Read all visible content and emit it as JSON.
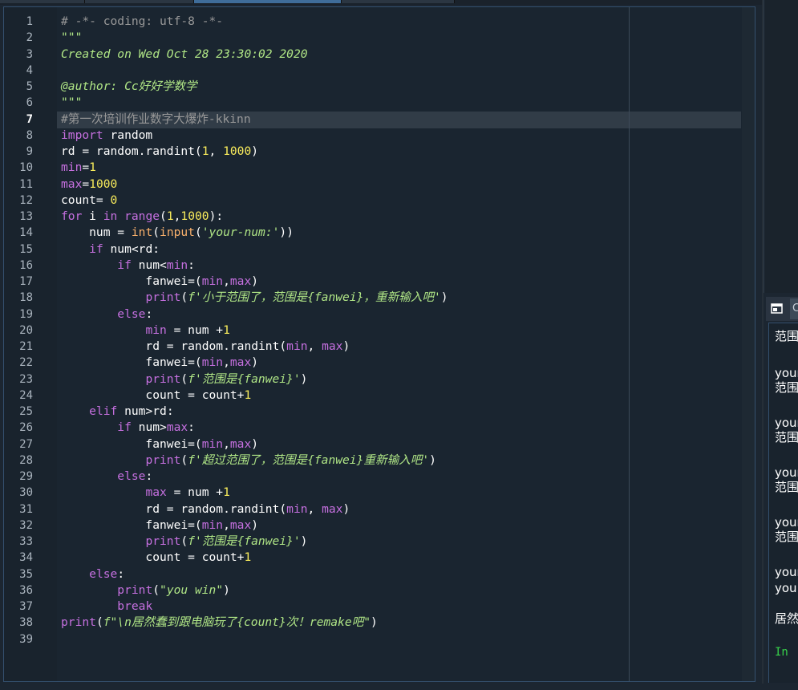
{
  "editor": {
    "current_line": 7,
    "lines": [
      [
        {
          "t": "# -*- coding: utf-8 -*-",
          "c": "cm"
        }
      ],
      [
        {
          "t": "\"\"\"",
          "c": "str"
        }
      ],
      [
        {
          "t": "Created on Wed Oct 28 23:30:02 2020",
          "c": "str"
        }
      ],
      [],
      [
        {
          "t": "@author: Cc好好学数学",
          "c": "str"
        }
      ],
      [
        {
          "t": "\"\"\"",
          "c": "str"
        }
      ],
      [
        {
          "t": "#第一次培训作业数字大爆炸-kkinn",
          "c": "cm"
        }
      ],
      [
        {
          "t": "import",
          "c": "kw"
        },
        {
          "t": " random"
        }
      ],
      [
        {
          "t": "rd = random.randint("
        },
        {
          "t": "1",
          "c": "num"
        },
        {
          "t": ", "
        },
        {
          "t": "1000",
          "c": "num"
        },
        {
          "t": ")"
        }
      ],
      [
        {
          "t": "min",
          "c": "var"
        },
        {
          "t": "="
        },
        {
          "t": "1",
          "c": "num"
        }
      ],
      [
        {
          "t": "max",
          "c": "var"
        },
        {
          "t": "="
        },
        {
          "t": "1000",
          "c": "num"
        }
      ],
      [
        {
          "t": "count= "
        },
        {
          "t": "0",
          "c": "num"
        }
      ],
      [
        {
          "t": "for",
          "c": "kw"
        },
        {
          "t": " i "
        },
        {
          "t": "in",
          "c": "kw"
        },
        {
          "t": " "
        },
        {
          "t": "range",
          "c": "var"
        },
        {
          "t": "("
        },
        {
          "t": "1",
          "c": "num"
        },
        {
          "t": ","
        },
        {
          "t": "1000",
          "c": "num"
        },
        {
          "t": "):"
        }
      ],
      [
        {
          "t": "    num = "
        },
        {
          "t": "int",
          "c": "bi"
        },
        {
          "t": "("
        },
        {
          "t": "input",
          "c": "bi"
        },
        {
          "t": "("
        },
        {
          "t": "'your-num:'",
          "c": "str"
        },
        {
          "t": "))"
        }
      ],
      [
        {
          "t": "    "
        },
        {
          "t": "if",
          "c": "kw"
        },
        {
          "t": " num<rd:"
        }
      ],
      [
        {
          "t": "        "
        },
        {
          "t": "if",
          "c": "kw"
        },
        {
          "t": " num<"
        },
        {
          "t": "min",
          "c": "var"
        },
        {
          "t": ":"
        }
      ],
      [
        {
          "t": "            fanwei=("
        },
        {
          "t": "min",
          "c": "var"
        },
        {
          "t": ","
        },
        {
          "t": "max",
          "c": "var"
        },
        {
          "t": ")"
        }
      ],
      [
        {
          "t": "            "
        },
        {
          "t": "print",
          "c": "var"
        },
        {
          "t": "("
        },
        {
          "t": "f'小于范围了，范围是{fanwei}，重新输入吧'",
          "c": "str"
        },
        {
          "t": ")"
        }
      ],
      [
        {
          "t": "        "
        },
        {
          "t": "else",
          "c": "kw"
        },
        {
          "t": ":"
        }
      ],
      [
        {
          "t": "            "
        },
        {
          "t": "min",
          "c": "var"
        },
        {
          "t": " = num +"
        },
        {
          "t": "1",
          "c": "num"
        }
      ],
      [
        {
          "t": "            rd = random.randint("
        },
        {
          "t": "min",
          "c": "var"
        },
        {
          "t": ", "
        },
        {
          "t": "max",
          "c": "var"
        },
        {
          "t": ")"
        }
      ],
      [
        {
          "t": "            fanwei=("
        },
        {
          "t": "min",
          "c": "var"
        },
        {
          "t": ","
        },
        {
          "t": "max",
          "c": "var"
        },
        {
          "t": ")"
        }
      ],
      [
        {
          "t": "            "
        },
        {
          "t": "print",
          "c": "var"
        },
        {
          "t": "("
        },
        {
          "t": "f'范围是{fanwei}'",
          "c": "str"
        },
        {
          "t": ")"
        }
      ],
      [
        {
          "t": "            count = count+"
        },
        {
          "t": "1",
          "c": "num"
        }
      ],
      [
        {
          "t": "    "
        },
        {
          "t": "elif",
          "c": "kw"
        },
        {
          "t": " num>rd:"
        }
      ],
      [
        {
          "t": "        "
        },
        {
          "t": "if",
          "c": "kw"
        },
        {
          "t": " num>"
        },
        {
          "t": "max",
          "c": "var"
        },
        {
          "t": ":"
        }
      ],
      [
        {
          "t": "            fanwei=("
        },
        {
          "t": "min",
          "c": "var"
        },
        {
          "t": ","
        },
        {
          "t": "max",
          "c": "var"
        },
        {
          "t": ")"
        }
      ],
      [
        {
          "t": "            "
        },
        {
          "t": "print",
          "c": "var"
        },
        {
          "t": "("
        },
        {
          "t": "f'超过范围了，范围是{fanwei}重新输入吧'",
          "c": "str"
        },
        {
          "t": ")"
        }
      ],
      [
        {
          "t": "        "
        },
        {
          "t": "else",
          "c": "kw"
        },
        {
          "t": ":"
        }
      ],
      [
        {
          "t": "            "
        },
        {
          "t": "max",
          "c": "var"
        },
        {
          "t": " = num +"
        },
        {
          "t": "1",
          "c": "num"
        }
      ],
      [
        {
          "t": "            rd = random.randint("
        },
        {
          "t": "min",
          "c": "var"
        },
        {
          "t": ", "
        },
        {
          "t": "max",
          "c": "var"
        },
        {
          "t": ")"
        }
      ],
      [
        {
          "t": "            fanwei=("
        },
        {
          "t": "min",
          "c": "var"
        },
        {
          "t": ","
        },
        {
          "t": "max",
          "c": "var"
        },
        {
          "t": ")"
        }
      ],
      [
        {
          "t": "            "
        },
        {
          "t": "print",
          "c": "var"
        },
        {
          "t": "("
        },
        {
          "t": "f'范围是{fanwei}'",
          "c": "str"
        },
        {
          "t": ")"
        }
      ],
      [
        {
          "t": "            count = count+"
        },
        {
          "t": "1",
          "c": "num"
        }
      ],
      [
        {
          "t": "    "
        },
        {
          "t": "else",
          "c": "kw"
        },
        {
          "t": ":"
        }
      ],
      [
        {
          "t": "        "
        },
        {
          "t": "print",
          "c": "var"
        },
        {
          "t": "("
        },
        {
          "t": "\"you win\"",
          "c": "str"
        },
        {
          "t": ")"
        }
      ],
      [
        {
          "t": "        "
        },
        {
          "t": "break",
          "c": "kw"
        }
      ],
      [
        {
          "t": "print",
          "c": "var"
        },
        {
          "t": "("
        },
        {
          "t": "f\"\\n居然蠢到跟电脑玩了{count}次！remake吧\"",
          "c": "str"
        },
        {
          "t": ")"
        }
      ],
      []
    ]
  },
  "console": {
    "tab_label": "C",
    "lines": [
      {
        "text": "范围",
        "kind": "out"
      },
      {
        "text": "",
        "kind": "out"
      },
      {
        "text": "your",
        "kind": "out"
      },
      {
        "text": "范围",
        "kind": "out"
      },
      {
        "text": "",
        "kind": "out"
      },
      {
        "text": "your",
        "kind": "out"
      },
      {
        "text": "范围",
        "kind": "out"
      },
      {
        "text": "",
        "kind": "out"
      },
      {
        "text": "your",
        "kind": "out"
      },
      {
        "text": "范围",
        "kind": "out"
      },
      {
        "text": "",
        "kind": "out"
      },
      {
        "text": "your",
        "kind": "out"
      },
      {
        "text": "范围",
        "kind": "out"
      },
      {
        "text": "",
        "kind": "out"
      },
      {
        "text": "your",
        "kind": "out"
      },
      {
        "text": "you",
        "kind": "out"
      },
      {
        "text": "",
        "kind": "out"
      },
      {
        "text": "居然",
        "kind": "out"
      },
      {
        "text": "",
        "kind": "out"
      },
      {
        "text": "In",
        "kind": "prompt"
      }
    ]
  },
  "colors": {
    "keyword": "#c670e0",
    "number": "#faed5c",
    "string": "#b0e686",
    "comment": "#999999",
    "builtin": "#fab16c",
    "background": "#19232d"
  }
}
